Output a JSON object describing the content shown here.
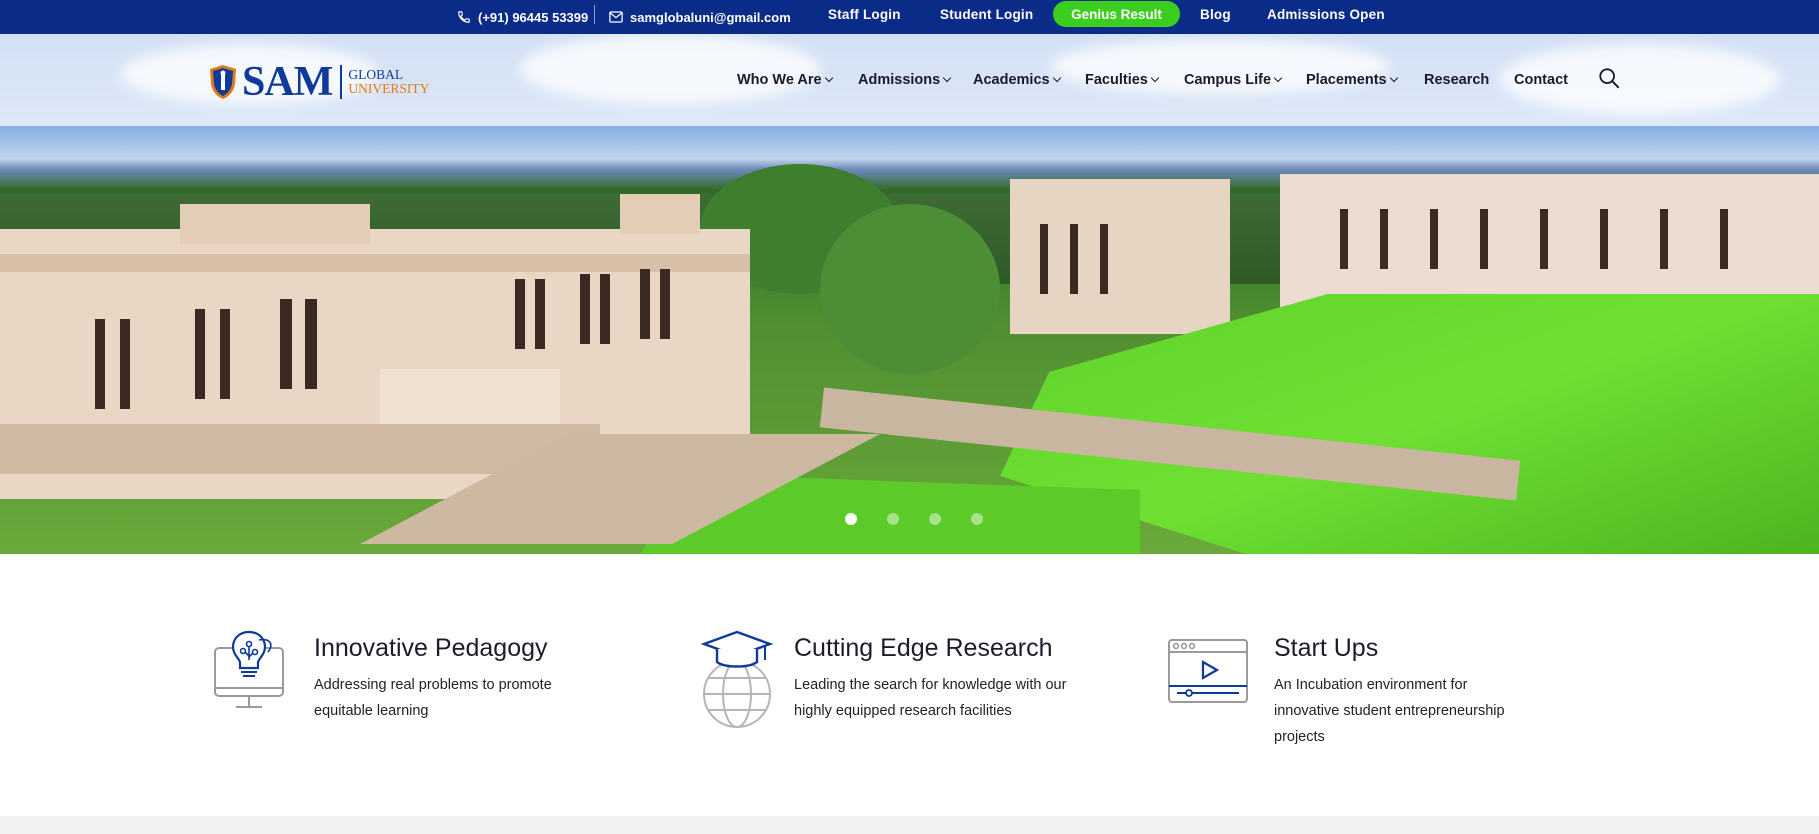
{
  "topbar": {
    "phone": "(+91) 96445 53399",
    "email": "samglobaluni@gmail.com",
    "links": [
      "Staff Login",
      "Student Login",
      "Genius Result",
      "Blog",
      "Admissions Open"
    ],
    "highlight_color": "#3cce1f",
    "background_color": "#0a2b88"
  },
  "header": {
    "logo": {
      "main": "SAM",
      "line1": "GLOBAL",
      "line2": "UNIVERSITY"
    },
    "nav": [
      {
        "label": "Who We Are",
        "has_dropdown": true
      },
      {
        "label": "Admissions",
        "has_dropdown": true
      },
      {
        "label": "Academics",
        "has_dropdown": true
      },
      {
        "label": "Faculties",
        "has_dropdown": true
      },
      {
        "label": "Campus Life",
        "has_dropdown": true
      },
      {
        "label": "Placements",
        "has_dropdown": true
      },
      {
        "label": "Research",
        "has_dropdown": false
      },
      {
        "label": "Contact",
        "has_dropdown": false
      }
    ],
    "search_icon": "search-icon"
  },
  "hero": {
    "slide_count": 4,
    "active_slide": 1
  },
  "features": [
    {
      "icon": "lightbulb-monitor-icon",
      "title": "Innovative Pedagogy",
      "description": "Addressing real problems to promote equitable learning"
    },
    {
      "icon": "graduation-globe-icon",
      "title": "Cutting Edge Research",
      "description": "Leading the search for knowledge with our highly equipped research facilities"
    },
    {
      "icon": "video-player-icon",
      "title": "Start Ups",
      "description": "An Incubation environment for innovative student entrepreneurship projects"
    }
  ]
}
